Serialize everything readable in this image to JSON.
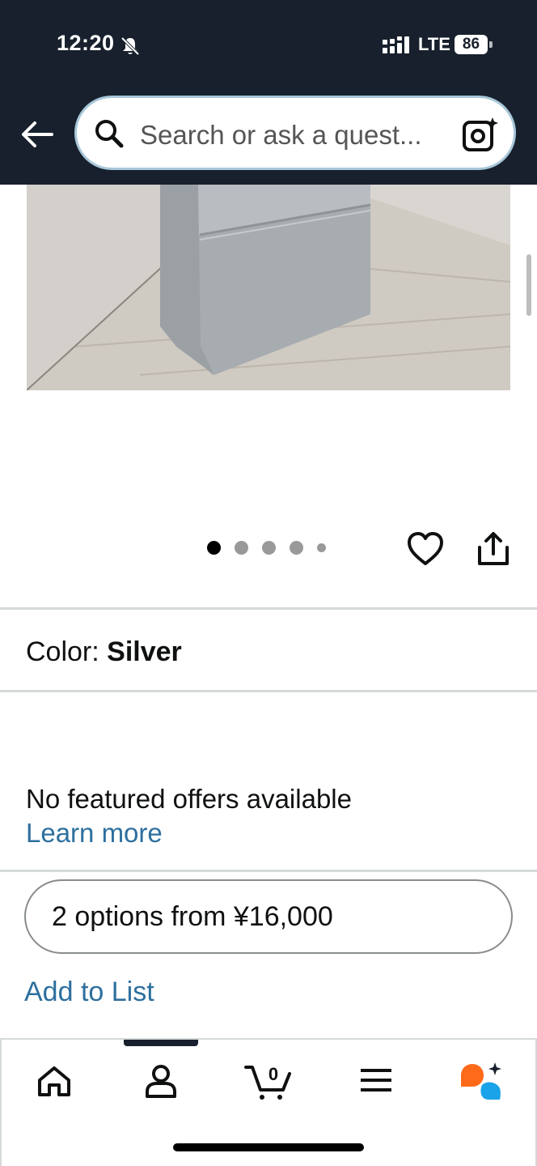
{
  "status_bar": {
    "time": "12:20",
    "network": "LTE",
    "battery": "86"
  },
  "search": {
    "placeholder": "Search or ask a quest..."
  },
  "product": {
    "image_count_dots": 5,
    "active_image": 1,
    "color_label": "Color:",
    "color_value": "Silver"
  },
  "offers": {
    "no_offers_text": "No featured offers available",
    "learn_more": "Learn more",
    "options_button": "2 options from ¥16,000",
    "add_to_list": "Add to List"
  },
  "bottom_nav": {
    "cart_count": "0",
    "items": [
      "home-icon",
      "account-icon",
      "cart-icon",
      "menu-icon",
      "rufus-icon"
    ]
  },
  "colors": {
    "header_bg": "#17202c",
    "link": "#2d6f9e",
    "accent_orange": "#ff6a1a",
    "accent_blue": "#1aa3e8"
  }
}
